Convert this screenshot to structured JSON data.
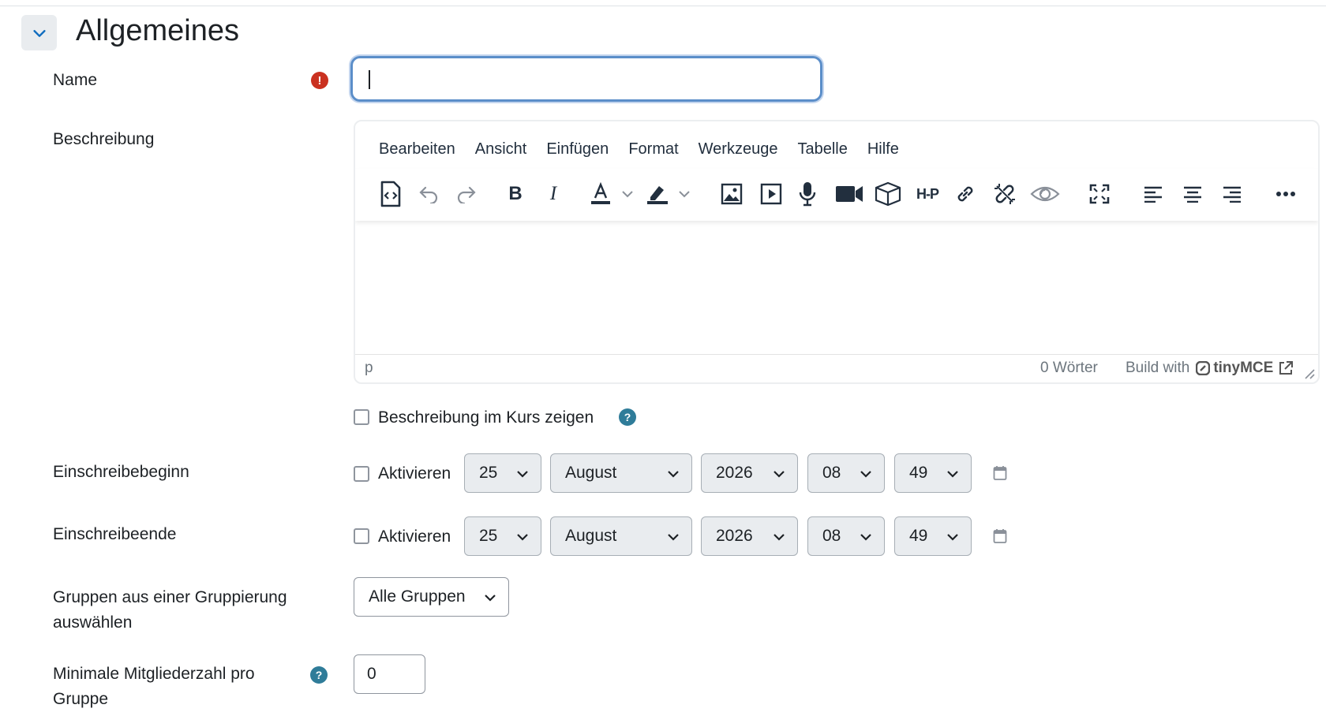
{
  "section": {
    "title": "Allgemeines"
  },
  "fields": {
    "name_label": "Name",
    "description_label": "Beschreibung",
    "name_value": ""
  },
  "editor": {
    "menu": [
      "Bearbeiten",
      "Ansicht",
      "Einfügen",
      "Format",
      "Werkzeuge",
      "Tabelle",
      "Hilfe"
    ],
    "status_path": "p",
    "word_count": "0 Wörter",
    "build_with": "Build with",
    "brand": "tinyMCE"
  },
  "show_description": {
    "label": "Beschreibung im Kurs zeigen",
    "checked": false
  },
  "enrol_start": {
    "label": "Einschreibebeginn",
    "enable_label": "Aktivieren",
    "day": "25",
    "month": "August",
    "year": "2026",
    "hour": "08",
    "minute": "49"
  },
  "enrol_end": {
    "label": "Einschreibeende",
    "enable_label": "Aktivieren",
    "day": "25",
    "month": "August",
    "year": "2026",
    "hour": "08",
    "minute": "49"
  },
  "grouping": {
    "label_line1": "Gruppen aus einer Gruppierung",
    "label_line2": "auswählen",
    "value": "Alle Gruppen"
  },
  "min_members": {
    "label_line1": "Minimale Mitgliederzahl pro",
    "label_line2": "Gruppe",
    "value": "0"
  },
  "colors": {
    "required": "#ca3120",
    "help": "#2f7c99",
    "focus": "#5b8ec9"
  }
}
